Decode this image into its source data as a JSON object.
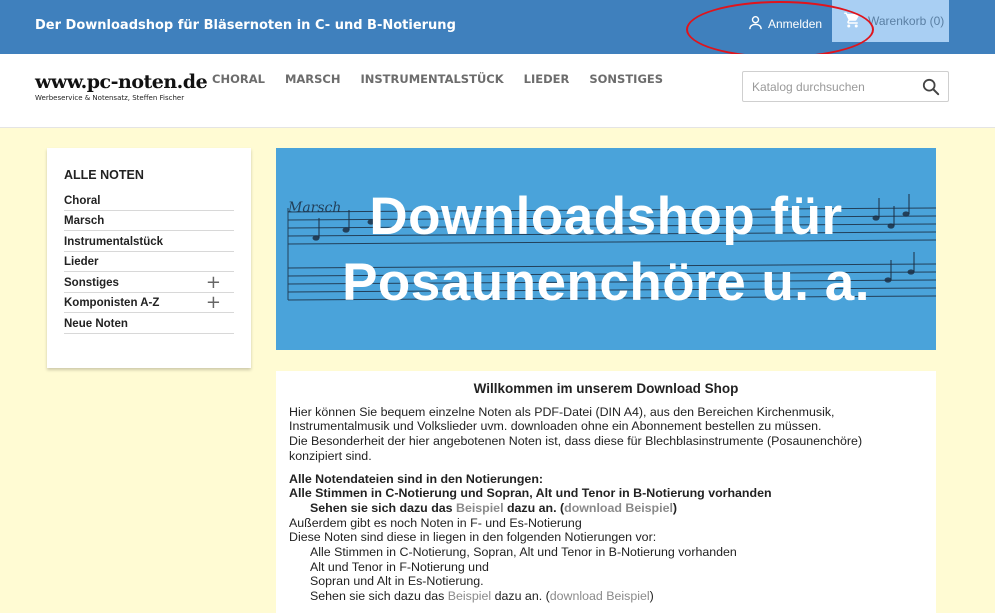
{
  "topbar": {
    "tagline": "Der Downloadshop für Bläsernoten in C- und B-Notierung",
    "login_label": "Anmelden",
    "cart_label": "Warenkorb (0)",
    "colors": {
      "bar": "#3f80bd",
      "cart": "#a9cff3",
      "annotation": "#e0141c"
    }
  },
  "header": {
    "logo_name": "www.pc-noten.de",
    "logo_sub": "Werbeservice & Notensatz, Steffen Fischer",
    "nav": [
      "CHORAL",
      "MARSCH",
      "INSTRUMENTALSTÜCK",
      "LIEDER",
      "SONSTIGES"
    ],
    "search_placeholder": "Katalog durchsuchen",
    "search_value": ""
  },
  "sidebar": {
    "title": "ALLE NOTEN",
    "items": [
      {
        "label": "Choral",
        "expandable": false
      },
      {
        "label": "Marsch",
        "expandable": false
      },
      {
        "label": "Instrumentalstück",
        "expandable": false
      },
      {
        "label": "Lieder",
        "expandable": false
      },
      {
        "label": "Sonstiges",
        "expandable": true
      },
      {
        "label": "Komponisten A-Z",
        "expandable": true
      },
      {
        "label": "Neue Noten",
        "expandable": false
      }
    ],
    "expand_symbol": "+"
  },
  "banner": {
    "line1": "Downloadshop für",
    "line2": "Posaunenchöre u. a.",
    "sheet_word": "Marsch",
    "color": "#4aa3da"
  },
  "content": {
    "heading": "Willkommen im unserem Download Shop",
    "intro": [
      "Hier können Sie bequem einzelne Noten als PDF-Datei (DIN A4), aus den Bereichen Kirchenmusik,",
      "Instrumentalmusik und Volkslieder uvm. downloaden ohne ein Abonnement bestellen zu müssen.",
      "Die Besonderheit der hier angebotenen Noten ist, dass diese für Blechblasinstrumente (Posaunenchöre)",
      "konzipiert sind."
    ],
    "bold1": "Alle Notendateien sind in den Notierungen:",
    "bold2": "Alle Stimmen in C-Notierung und Sopran, Alt und Tenor in B-Notierung vorhanden",
    "see1_pre": "Sehen sie sich dazu das ",
    "see1_link": "Beispiel",
    "see1_mid": " dazu an. (",
    "see1_link2": "download Beispiel",
    "see1_post": ")",
    "extra": "Außerdem gibt es noch Noten in F- und Es-Notierung",
    "extra2": "Diese Noten sind diese in liegen in den folgenden Notierungen vor:",
    "list": [
      "Alle Stimmen in C-Notierung, Sopran, Alt und Tenor in B-Notierung vorhanden",
      "Alt und Tenor in F-Notierung und",
      "Sopran und Alt in Es-Notierung."
    ],
    "see2_pre": "Sehen sie sich dazu das ",
    "see2_link": "Beispiel",
    "see2_mid": " dazu an. (",
    "see2_link2": "download Beispiel",
    "see2_post": ")"
  }
}
